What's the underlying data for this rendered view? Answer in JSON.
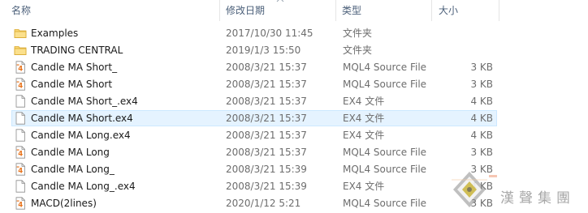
{
  "header": {
    "name_label": "名称",
    "date_label": "修改日期",
    "type_label": "类型",
    "size_label": "大小"
  },
  "files": [
    {
      "name": "Examples",
      "date": "2017/10/30 11:45",
      "type": "文件夹",
      "size": "",
      "icon": "folder-icon"
    },
    {
      "name": "TRADING CENTRAL",
      "date": "2019/1/3 15:50",
      "type": "文件夹",
      "size": "",
      "icon": "folder-icon"
    },
    {
      "name": "Candle MA Short_",
      "date": "2008/3/21 15:37",
      "type": "MQL4 Source File",
      "size": "3 KB",
      "icon": "mql4-file-icon"
    },
    {
      "name": "Candle MA Short",
      "date": "2008/3/21 15:37",
      "type": "MQL4 Source File",
      "size": "3 KB",
      "icon": "mql4-file-icon"
    },
    {
      "name": "Candle MA Short_.ex4",
      "date": "2008/3/21 15:37",
      "type": "EX4 文件",
      "size": "4 KB",
      "icon": "blank-file-icon"
    },
    {
      "name": "Candle MA Short.ex4",
      "date": "2008/3/21 15:37",
      "type": "EX4 文件",
      "size": "4 KB",
      "icon": "blank-file-icon",
      "hover": true
    },
    {
      "name": "Candle MA Long.ex4",
      "date": "2008/3/21 15:37",
      "type": "EX4 文件",
      "size": "4 KB",
      "icon": "blank-file-icon"
    },
    {
      "name": "Candle MA Long",
      "date": "2008/3/21 15:37",
      "type": "MQL4 Source File",
      "size": "3 KB",
      "icon": "mql4-file-icon"
    },
    {
      "name": "Candle MA Long_",
      "date": "2008/3/21 15:39",
      "type": "MQL4 Source File",
      "size": "3 KB",
      "icon": "mql4-file-icon"
    },
    {
      "name": "Candle MA Long_.ex4",
      "date": "2008/3/21 15:39",
      "type": "EX4 文件",
      "size": "4 KB",
      "icon": "blank-file-icon"
    },
    {
      "name": "MACD(2lines)",
      "date": "2020/1/12 5:21",
      "type": "MQL4 Source File",
      "size": "3 KB",
      "icon": "mql4-file-icon"
    }
  ],
  "watermark": {
    "text": "漢聲集團"
  },
  "colors": {
    "folder": "#f8d775",
    "hover_bg": "#e5f3ff",
    "hover_border": "#cce8ff",
    "header_text": "#4c607a",
    "mql4_accent": "#e8731c"
  }
}
